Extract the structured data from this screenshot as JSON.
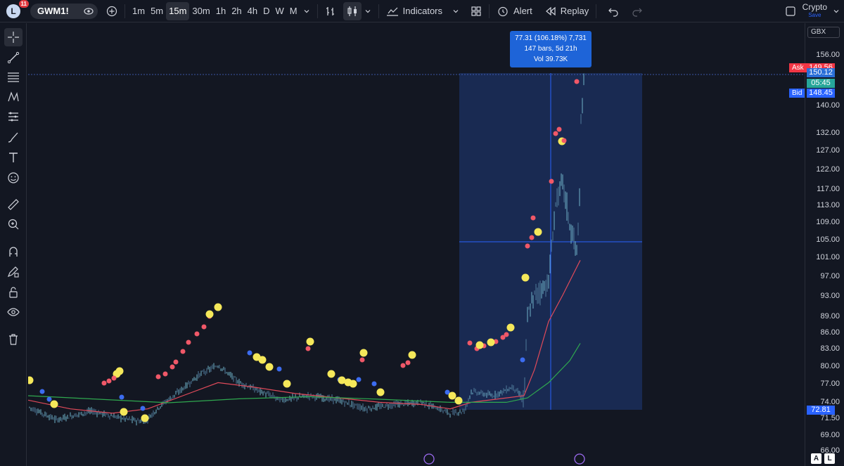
{
  "header": {
    "logo_letter": "L",
    "notification_count": "11",
    "symbol": "GWM1!",
    "timeframes": [
      "1m",
      "5m",
      "15m",
      "30m",
      "1h",
      "2h",
      "4h",
      "D",
      "W",
      "M"
    ],
    "active_timeframe": "15m",
    "indicators_label": "Indicators",
    "alert_label": "Alert",
    "replay_label": "Replay",
    "crypto_label": "Crypto",
    "crypto_sub": "Save"
  },
  "left_toolbar": {
    "tools": [
      "crosshair-icon",
      "trendline-icon",
      "fib-icon",
      "pattern-icon",
      "multi-line-icon",
      "brush-icon",
      "text-icon",
      "emoji-icon",
      "ruler-icon",
      "zoom-in-icon",
      "magnet-icon",
      "pencil-lock-icon",
      "lock-icon",
      "eye-icon",
      "trash-icon"
    ]
  },
  "price_scale": {
    "currency": "GBX",
    "labels": [
      "156.00",
      "140.00",
      "132.00",
      "127.00",
      "122.00",
      "117.00",
      "113.00",
      "109.00",
      "105.00",
      "101.00",
      "97.00",
      "93.00",
      "89.00",
      "86.00",
      "83.00",
      "80.00",
      "77.00",
      "74.00",
      "71.50",
      "69.00",
      "66.00"
    ],
    "ask_label": "Ask",
    "ask_price": "149.56",
    "last_price": "150.12",
    "countdown": "05:45",
    "bid_label": "Bid",
    "bid_price": "148.45",
    "range_low_price": "72.81"
  },
  "measure_tooltip": {
    "line1": "77.31 (106.18%) 7,731",
    "line2": "147 bars, 5d 21h",
    "line3": "Vol 39.73K"
  },
  "bottom_buttons": {
    "auto": "A",
    "log": "L"
  },
  "colors": {
    "background": "#131722",
    "measure_box": "#1f3a7a",
    "tooltip": "#1e64d8",
    "ask": "#f23645",
    "bid": "#2962ff",
    "last_price": "#26a69a",
    "ma_fast": "#e04a5a",
    "ma_slow": "#2fa84f",
    "dot_red": "#f05868",
    "dot_blue": "#3c6cf0",
    "dot_yellow": "#f5e85a"
  }
}
